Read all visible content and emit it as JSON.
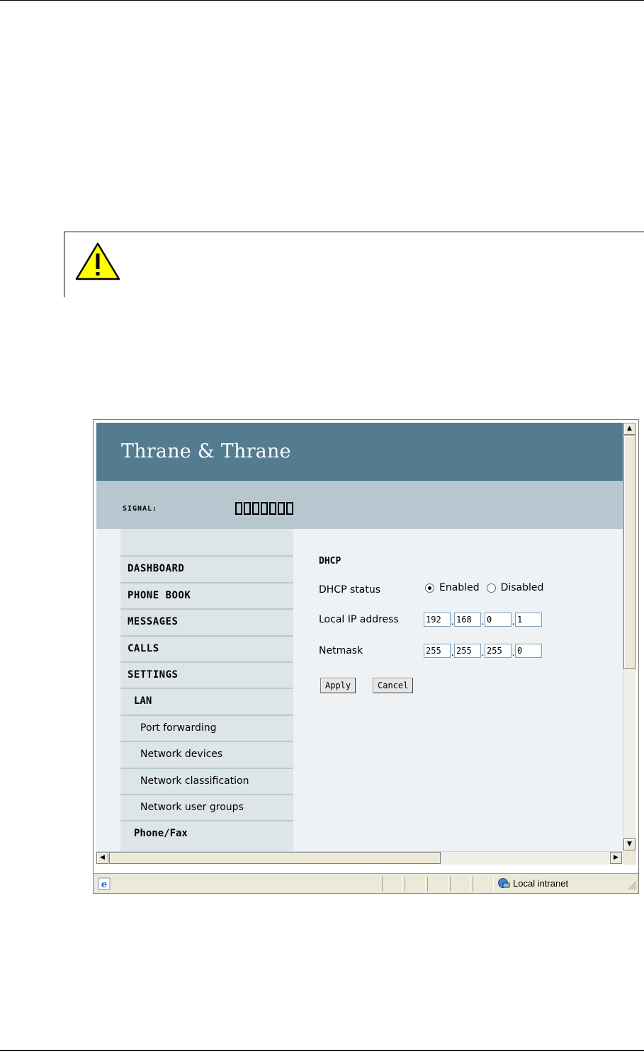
{
  "app": {
    "brand": "Thrane & Thrane",
    "signal_label": "SIGNAL:",
    "signal_bar_count": 7
  },
  "nav": {
    "items": [
      {
        "label": "",
        "level": "top"
      },
      {
        "label": "DASHBOARD",
        "level": "top"
      },
      {
        "label": "PHONE BOOK",
        "level": "top"
      },
      {
        "label": "MESSAGES",
        "level": "top"
      },
      {
        "label": "CALLS",
        "level": "top"
      },
      {
        "label": "SETTINGS",
        "level": "top"
      },
      {
        "label": "LAN",
        "level": "sub"
      },
      {
        "label": "Port forwarding",
        "level": "sub2"
      },
      {
        "label": "Network devices",
        "level": "sub2"
      },
      {
        "label": "Network classification",
        "level": "sub2"
      },
      {
        "label": "Network user groups",
        "level": "sub2"
      },
      {
        "label": "Phone/Fax",
        "level": "sub"
      }
    ]
  },
  "form": {
    "title": "DHCP",
    "dhcp_status_label": "DHCP status",
    "enabled_label": "Enabled",
    "disabled_label": "Disabled",
    "dhcp_selected": "Enabled",
    "local_ip_label": "Local IP address",
    "local_ip": [
      "192",
      "168",
      "0",
      "1"
    ],
    "netmask_label": "Netmask",
    "netmask": [
      "255",
      "255",
      "255",
      "0"
    ],
    "dot": ".",
    "apply_label": "Apply",
    "cancel_label": "Cancel"
  },
  "statusbar": {
    "zone": "Local intranet"
  },
  "colors": {
    "header": "#537c91",
    "signal_band": "#b6c7cf",
    "nav_bg": "#dde5e9",
    "content_bg": "#eff2f4",
    "warning_yellow": "#ffff00"
  }
}
